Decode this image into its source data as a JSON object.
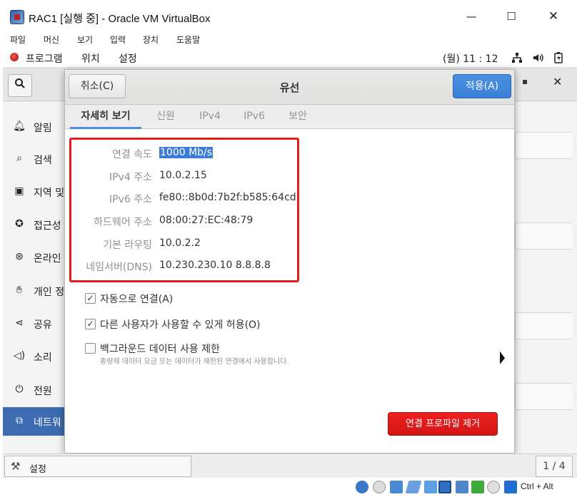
{
  "window": {
    "title": "RAC1 [실행 중] - Oracle VM VirtualBox",
    "minimize_glyph": "—",
    "maximize_glyph": "☐",
    "close_glyph": "✕"
  },
  "vbox_menu": [
    "파일",
    "머신",
    "보기",
    "입력",
    "장치",
    "도움말"
  ],
  "gnome_topbar": {
    "programs": "프로그램",
    "places": "위치",
    "settings": "설정",
    "clock": "(월) 11 : 12",
    "tray_icons": [
      "network-wired-icon",
      "volume-icon",
      "battery-icon"
    ]
  },
  "settings_window": {
    "search_icon": "search-icon",
    "sidebar": [
      {
        "icon": "bell-icon",
        "label": "알림"
      },
      {
        "icon": "search-icon",
        "label": "검색"
      },
      {
        "icon": "camera-icon",
        "label": "지역 및"
      },
      {
        "icon": "accessibility-icon",
        "label": "접근성"
      },
      {
        "icon": "online-accounts-icon",
        "label": "온라인"
      },
      {
        "icon": "hand-icon",
        "label": "개인 정"
      },
      {
        "icon": "share-icon",
        "label": "공유"
      },
      {
        "icon": "speaker-icon",
        "label": "소리"
      },
      {
        "icon": "power-icon",
        "label": "전원"
      },
      {
        "icon": "network-icon",
        "label": "네트워"
      }
    ],
    "active_item": "네트워"
  },
  "dialog": {
    "title": "유선",
    "cancel_label": "취소(C)",
    "apply_label": "적용(A)",
    "tabs": [
      "자세히 보기",
      "신원",
      "IPv4",
      "IPv6",
      "보안"
    ],
    "active_tab": "자세히 보기",
    "details": [
      {
        "label": "연결 속도",
        "value": "1000 Mb/s"
      },
      {
        "label": "IPv4 주소",
        "value": "10.0.2.15"
      },
      {
        "label": "IPv6 주소",
        "value": "fe80::8b0d:7b2f:b585:64cd"
      },
      {
        "label": "하드웨어 주소",
        "value": "08:00:27:EC:48:79"
      },
      {
        "label": "기본 라우팅",
        "value": "10.0.2.2"
      },
      {
        "label": "네임서버(DNS)",
        "value": "10.230.230.10 8.8.8.8"
      }
    ],
    "checkboxes": [
      {
        "label": "자동으로 연결(A)",
        "checked": true
      },
      {
        "label": "다른 사용자가 사용할 수 있게 허용(O)",
        "checked": true
      },
      {
        "label": "백그라운드 데이터 사용 제한",
        "checked": false,
        "subtext": "종량제 데이터 요금 또는 데이터가 제한된 연결에서 사용합니다."
      }
    ],
    "remove_label": "연결 프로파일 제거",
    "highlight_color": "#e61b1b",
    "apply_color": "#4a90e2",
    "remove_color": "#e01818"
  },
  "bottom_bar": {
    "settings_label": "설정",
    "page_indicator": "1 / 4"
  },
  "vbox_status": {
    "host_key": "Ctrl + Alt",
    "icons": [
      "hard-disk-icon",
      "optical-disc-icon",
      "audio-icon",
      "network-adapter-icon",
      "usb-icon",
      "shared-folders-icon",
      "display-icon",
      "video-capture-icon",
      "green-arrow-icon",
      "mouse-integration-icon",
      "keyboard-capture-icon"
    ]
  }
}
